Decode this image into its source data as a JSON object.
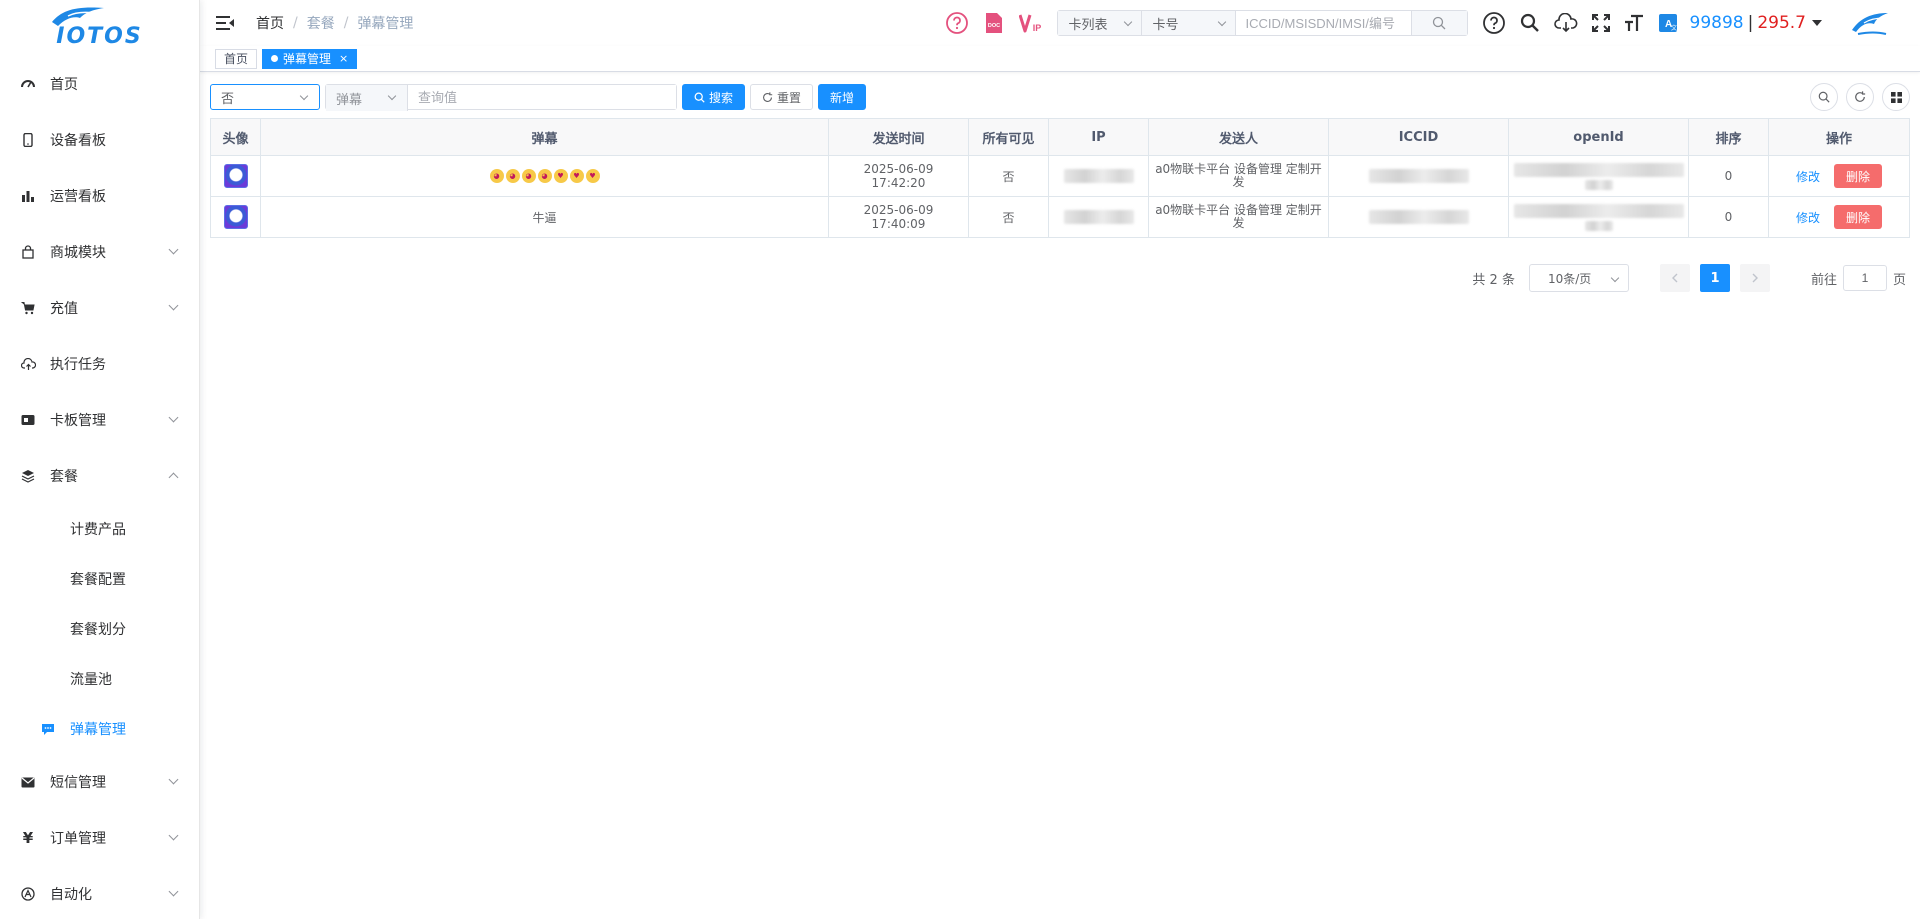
{
  "logo": {
    "text": "IOTOS"
  },
  "sidebar": {
    "items": [
      {
        "label": "首页",
        "icon": "dashboard-icon"
      },
      {
        "label": "设备看板",
        "icon": "phone-icon"
      },
      {
        "label": "运营看板",
        "icon": "bar-chart-icon"
      },
      {
        "label": "商城模块",
        "icon": "shopping-bag-icon"
      },
      {
        "label": "充值",
        "icon": "cart-icon"
      },
      {
        "label": "执行任务",
        "icon": "cloud-upload-icon"
      },
      {
        "label": "卡板管理",
        "icon": "sim-card-icon"
      },
      {
        "label": "套餐",
        "icon": "layers-icon"
      }
    ],
    "sub_items": [
      {
        "label": "计费产品"
      },
      {
        "label": "套餐配置"
      },
      {
        "label": "套餐划分"
      },
      {
        "label": "流量池"
      },
      {
        "label": "弹幕管理",
        "icon": "chat-icon"
      }
    ],
    "bottom_items": [
      {
        "label": "短信管理",
        "icon": "mail-icon"
      },
      {
        "label": "订单管理",
        "icon": "yen-icon"
      },
      {
        "label": "自动化",
        "icon": "robot-icon"
      }
    ]
  },
  "breadcrumb": [
    "首页",
    "套餐",
    "弹幕管理"
  ],
  "navbar": {
    "vip": "VIP",
    "doc": "DOC",
    "card_select": "卡列表",
    "type_select": "卡号",
    "search_placeholder": "ICCID/MSISDN/IMSI/编号",
    "count": "99898",
    "separator": "|",
    "balance": "295.7"
  },
  "tags": [
    {
      "label": "首页"
    },
    {
      "label": "弹幕管理",
      "close": "×"
    }
  ],
  "filters": {
    "visible_select": "否",
    "field_select": "弹幕",
    "query_placeholder": "查询值",
    "search_btn": "搜索",
    "reset_btn": "重置",
    "add_btn": "新增"
  },
  "table": {
    "headers": [
      "头像",
      "弹幕",
      "发送时间",
      "所有可见",
      "IP",
      "发送人",
      "ICCID",
      "openId",
      "排序",
      "操作"
    ],
    "rows": [
      {
        "danmu": "",
        "emoji": true,
        "time": "2025-06-09 17:42:20",
        "visible": "否",
        "sender": "a0物联卡平台 设备管理 定制开发",
        "sort": "0"
      },
      {
        "danmu": "牛逼",
        "emoji": false,
        "time": "2025-06-09 17:40:09",
        "visible": "否",
        "sender": "a0物联卡平台 设备管理 定制开发",
        "sort": "0"
      }
    ],
    "edit_label": "修改",
    "delete_label": "删除"
  },
  "pagination": {
    "total": "共 2 条",
    "page_size": "10条/页",
    "current": "1",
    "goto_prefix": "前往",
    "goto_value": "1",
    "goto_suffix": "页"
  },
  "colors": {
    "primary": "#1890ff",
    "danger": "#f56c6c",
    "pink": "#e4517e",
    "balance": "#e02020"
  }
}
